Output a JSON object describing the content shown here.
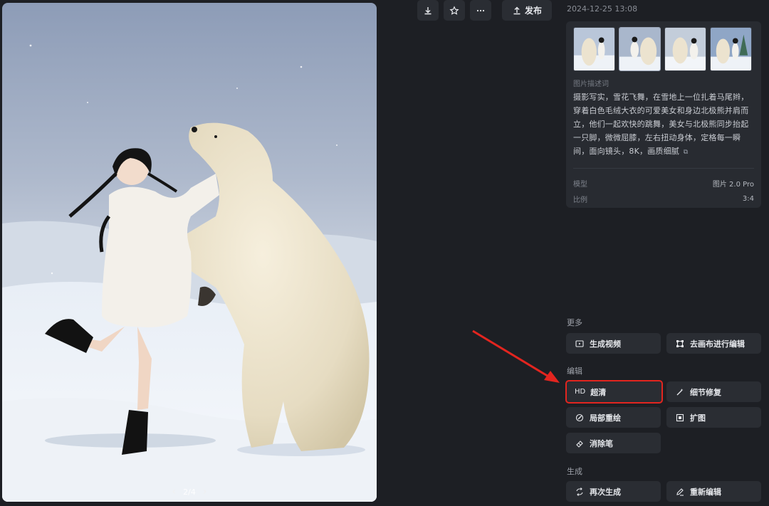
{
  "toolbar": {
    "download_icon": "download-icon",
    "star_icon": "star-icon",
    "more_icon": "more-icon",
    "publish_label": "发布"
  },
  "image_viewer": {
    "pager_text": "2/4",
    "prev_icon": "chevron-left-icon",
    "next_icon": "chevron-right-icon"
  },
  "info": {
    "timestamp": "2024-12-25 13:08",
    "thumbnails_count": 4,
    "prompt_label": "图片描述词",
    "prompt_text": "摄影写实，雪花飞舞，在雪地上一位扎着马尾辫，穿着白色毛绒大衣的可爱美女和身边北极熊并肩而立，他们一起欢快的跳舞，美女与北极熊同步抬起一只脚，微微屈膝，左右扭动身体，定格每一瞬间，面向镜头，8K，画质细腻",
    "model_label": "模型",
    "model_value": "图片 2.0 Pro",
    "ratio_label": "比例",
    "ratio_value": "3:4"
  },
  "sections": {
    "more_title": "更多",
    "edit_title": "编辑",
    "generate_title": "生成"
  },
  "actions": {
    "generate_video": "生成视频",
    "canvas_edit": "去画布进行编辑",
    "hd_icon_text": "HD",
    "super_res": "超清",
    "detail_fix": "细节修复",
    "partial_redraw": "局部重绘",
    "expand": "扩图",
    "eraser": "消除笔",
    "regenerate": "再次生成",
    "re_edit": "重新编辑"
  },
  "colors": {
    "background": "#1d1f24",
    "button_bg": "#2a2d33",
    "highlight_border": "#e3251f",
    "annotation_arrow": "#e3251f"
  }
}
